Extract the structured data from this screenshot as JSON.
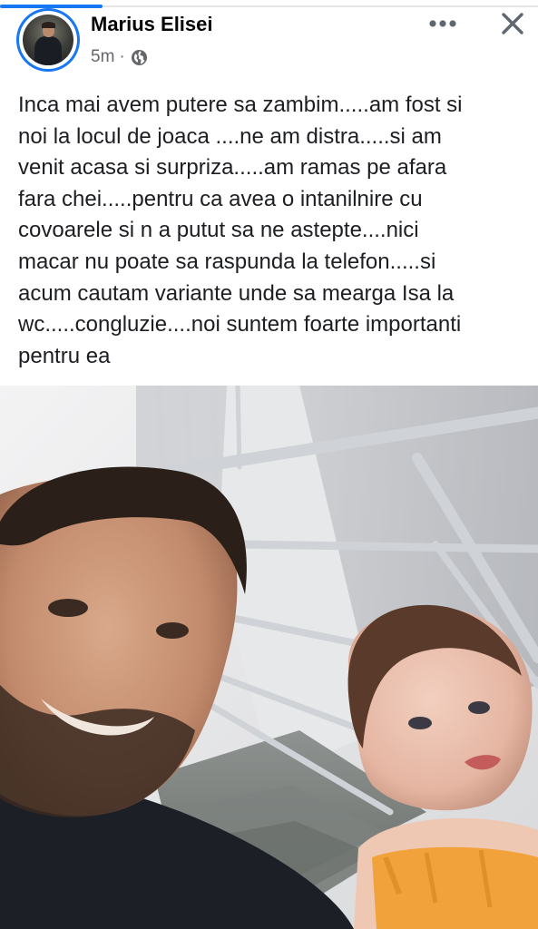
{
  "progress": {
    "fraction": 0.19,
    "accent_color": "#1877f2"
  },
  "post": {
    "author_name": "Marius Elisei",
    "timestamp": "5m",
    "separator": "·",
    "audience_icon": "globe-icon",
    "more_icon": "more-options-icon",
    "close_icon": "close-icon",
    "text_lines": [
      "Inca mai avem putere sa zambim.....am fost si",
      "noi la locul de joaca ....ne am distra.....si am",
      "venit acasa si surpriza.....am ramas pe afara",
      "fara chei.....pentru ca avea o intanilnire cu",
      "covoarele si n a putut sa ne astepte....nici",
      "macar nu poate sa raspunda la telefon.....si",
      "acum cautam variante unde sa mearga Isa la",
      "wc.....congluzie....noi suntem foarte importanti",
      "pentru ea"
    ]
  }
}
